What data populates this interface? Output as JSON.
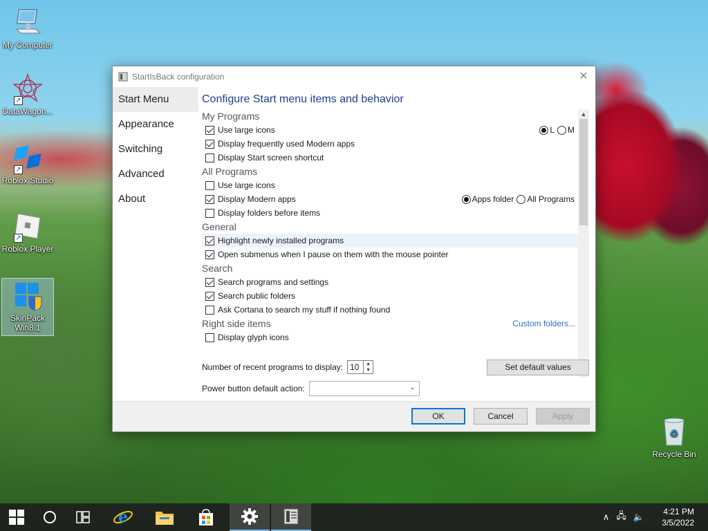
{
  "desktop": {
    "icons": [
      {
        "label": "My Computer"
      },
      {
        "label": "DataWagon..."
      },
      {
        "label": "Roblox Studio"
      },
      {
        "label": "Roblox Player"
      },
      {
        "label": "SkinPack Win8.1"
      },
      {
        "label": "Recycle Bin"
      }
    ]
  },
  "window": {
    "title": "StartIsBack configuration",
    "nav": [
      "Start Menu",
      "Appearance",
      "Switching",
      "Advanced",
      "About"
    ],
    "heading": "Configure Start menu items and behavior",
    "sections": {
      "my_programs": {
        "title": "My Programs",
        "items": [
          {
            "label": "Use large icons",
            "checked": true
          },
          {
            "label": "Display frequently used Modern apps",
            "checked": true
          },
          {
            "label": "Display Start screen shortcut",
            "checked": false
          }
        ],
        "radio": [
          {
            "label": "L",
            "selected": true
          },
          {
            "label": "M",
            "selected": false
          }
        ]
      },
      "all_programs": {
        "title": "All Programs",
        "items": [
          {
            "label": "Use large icons",
            "checked": false
          },
          {
            "label": "Display Modern apps",
            "checked": true
          },
          {
            "label": "Display folders before items",
            "checked": false
          }
        ],
        "radio": [
          {
            "label": "Apps folder",
            "selected": true
          },
          {
            "label": "All Programs",
            "selected": false
          }
        ]
      },
      "general": {
        "title": "General",
        "items": [
          {
            "label": "Highlight newly installed programs",
            "checked": true
          },
          {
            "label": "Open submenus when I pause on them with the mouse pointer",
            "checked": true
          }
        ]
      },
      "search": {
        "title": "Search",
        "items": [
          {
            "label": "Search programs and settings",
            "checked": true
          },
          {
            "label": "Search public folders",
            "checked": true
          },
          {
            "label": "Ask Cortana to search my stuff if nothing found",
            "checked": false
          }
        ]
      },
      "right_side": {
        "title": "Right side items",
        "link": "Custom folders...",
        "items": [
          {
            "label": "Display glyph icons",
            "checked": false
          }
        ]
      }
    },
    "recent_label": "Number of recent programs to display:",
    "recent_value": "10",
    "default_button": "Set default values",
    "power_label": "Power button default action:",
    "power_value": "",
    "buttons": {
      "ok": "OK",
      "cancel": "Cancel",
      "apply": "Apply"
    }
  },
  "taskbar": {
    "time": "4:21 PM",
    "date": "3/5/2022"
  },
  "colors": {
    "heading": "#1e3f8c",
    "link": "#2f6fc0",
    "focus": "#0078d7",
    "taskbar": "#1e1e1e"
  }
}
